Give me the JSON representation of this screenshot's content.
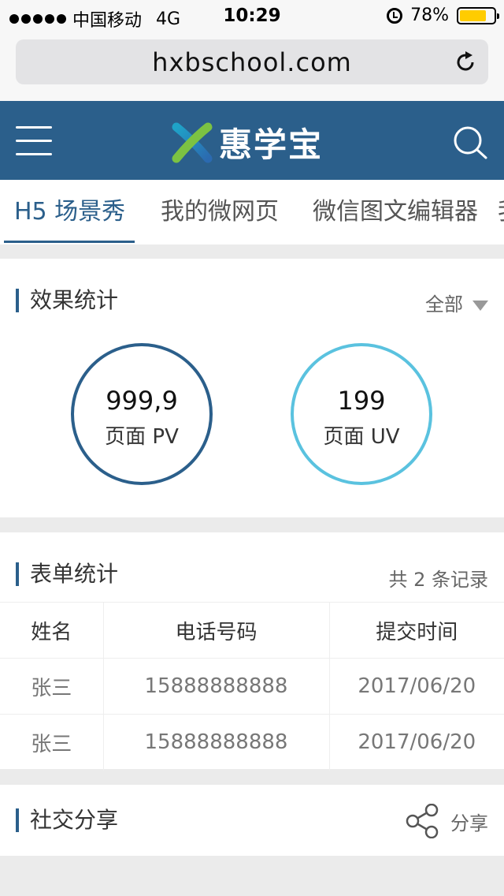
{
  "status_bar": {
    "carrier": "中国移动",
    "network": "4G",
    "time": "10:29",
    "battery": "78%",
    "battery_level": 0.78
  },
  "browser": {
    "url": "hxbschool.com"
  },
  "header": {
    "logo_text": "惠学宝"
  },
  "tabs": [
    {
      "label": "H5 场景秀",
      "active": true
    },
    {
      "label": "我的微网页",
      "active": false
    },
    {
      "label": "微信图文编辑器",
      "active": false
    },
    {
      "label": "我",
      "active": false
    }
  ],
  "effect_stats": {
    "title": "效果统计",
    "filter": "全部",
    "pv": {
      "value": "999,9",
      "label": "页面 PV"
    },
    "uv": {
      "value": "199",
      "label": "页面 UV"
    }
  },
  "form_stats": {
    "title": "表单统计",
    "record_count": "共 2 条记录",
    "columns": [
      "姓名",
      "电话号码",
      "提交时间"
    ],
    "rows": [
      [
        "张三",
        "15888888888",
        "2017/06/20"
      ],
      [
        "张三",
        "15888888888",
        "2017/06/20"
      ]
    ]
  },
  "social_share": {
    "title": "社交分享",
    "share_label": "分享"
  },
  "colors": {
    "brand": "#2b5f8b",
    "uv_ring": "#5ac2df",
    "battery": "#ffcc00"
  }
}
